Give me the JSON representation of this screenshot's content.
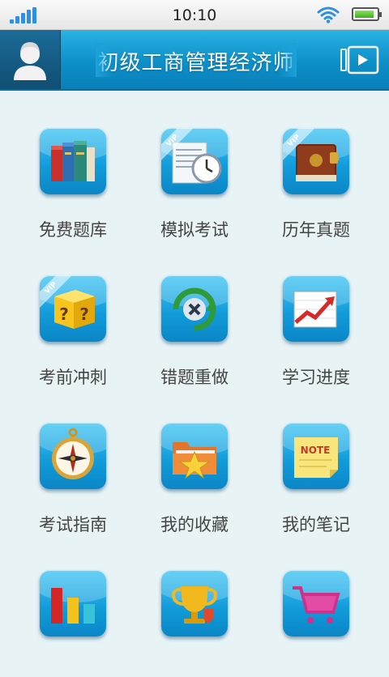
{
  "status_bar": {
    "time": "10:10"
  },
  "header": {
    "title": "初级工商管理经济师"
  },
  "menu": [
    {
      "label": "免费题库",
      "icon": "books-icon",
      "vip": false
    },
    {
      "label": "模拟考试",
      "icon": "clock-document-icon",
      "vip": true
    },
    {
      "label": "历年真题",
      "icon": "locked-book-icon",
      "vip": true
    },
    {
      "label": "考前冲刺",
      "icon": "question-box-icon",
      "vip": true
    },
    {
      "label": "错题重做",
      "icon": "redo-cross-icon",
      "vip": false
    },
    {
      "label": "学习进度",
      "icon": "progress-chart-icon",
      "vip": false
    },
    {
      "label": "考试指南",
      "icon": "compass-icon",
      "vip": false
    },
    {
      "label": "我的收藏",
      "icon": "star-folder-icon",
      "vip": false
    },
    {
      "label": "我的笔记",
      "icon": "note-icon",
      "vip": false
    },
    {
      "label": "",
      "icon": "bar-chart-icon",
      "vip": false
    },
    {
      "label": "",
      "icon": "trophy-icon",
      "vip": false
    },
    {
      "label": "",
      "icon": "shopping-cart-icon",
      "vip": false
    }
  ],
  "vip_text": "VIP",
  "note_text": "NOTE"
}
